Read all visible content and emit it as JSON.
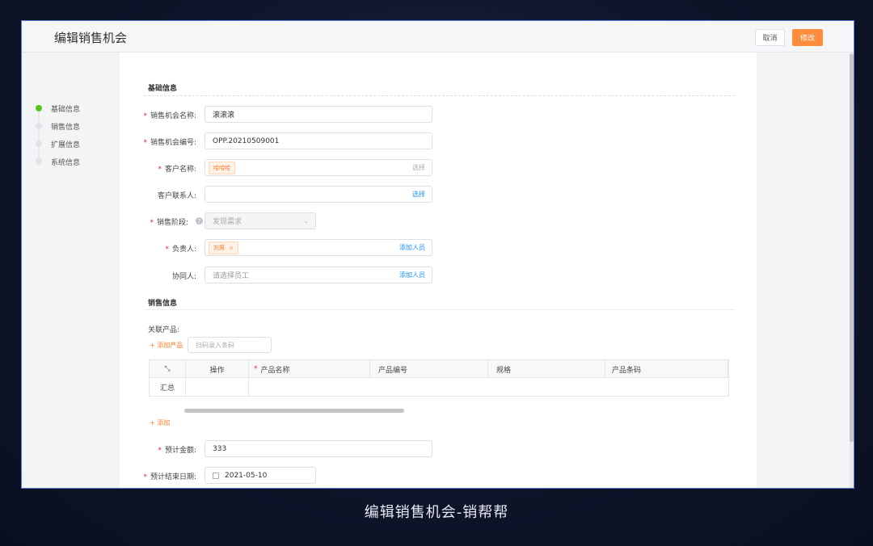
{
  "header": {
    "title": "编辑销售机会",
    "cancel_label": "取消",
    "save_label": "修改"
  },
  "steps": [
    "基础信息",
    "销售信息",
    "扩展信息",
    "系统信息"
  ],
  "sections": {
    "basic": "基础信息",
    "sales": "销售信息"
  },
  "form": {
    "opportunity_name": {
      "label": "销售机会名称:",
      "value": "滚滚滚"
    },
    "opportunity_code": {
      "label": "销售机会编号:",
      "value": "OPP.20210509001"
    },
    "customer_name": {
      "label": "客户名称:",
      "tag": "哈哈哈",
      "action": "选择"
    },
    "customer_contact": {
      "label": "客户联系人:",
      "action": "选择"
    },
    "sales_stage": {
      "label": "销售阶段:",
      "value": "发现需求"
    },
    "owner": {
      "label": "负责人:",
      "tag": "刘男",
      "tag_close": "×",
      "action": "添加人员"
    },
    "collaborator": {
      "label": "协同人:",
      "placeholder": "请选择员工",
      "action": "添加人员"
    },
    "related_products": {
      "label": "关联产品:",
      "add_label": "添加产品",
      "scan_placeholder": "扫码录入条码"
    },
    "expected_amount": {
      "label": "预计金额:",
      "value": "333"
    },
    "expected_close_date": {
      "label": "预计结束日期:",
      "value": "2021-05-10"
    }
  },
  "product_table": {
    "columns": [
      "操作",
      "产品名称",
      "产品编号",
      "规格",
      "产品条码"
    ],
    "summary_label": "汇总"
  },
  "add_label": "添加",
  "caption": "编辑销售机会-销帮帮",
  "colors": {
    "accent": "#ff8b3d",
    "active_step": "#52c41a",
    "link": "#1890ff",
    "required": "#f5222d"
  }
}
